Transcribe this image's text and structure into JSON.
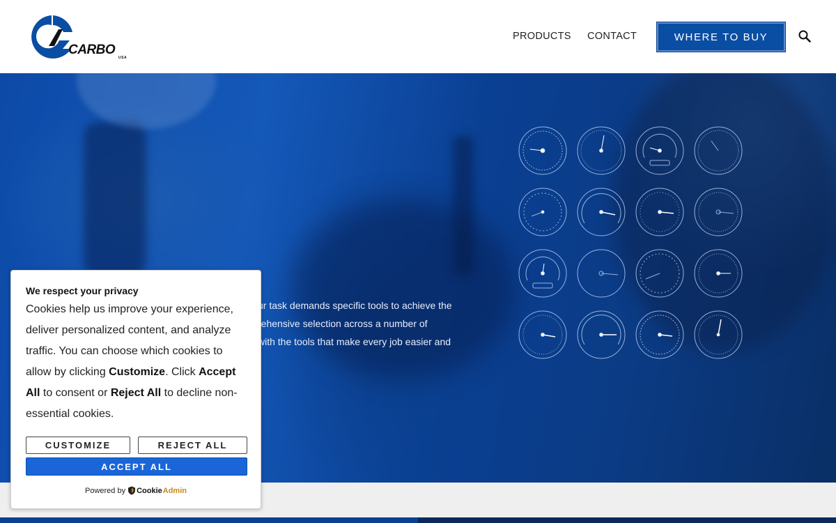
{
  "header": {
    "logo_text": "CARBO",
    "logo_sub": "USA",
    "nav": [
      "PRODUCTS",
      "CONTACT"
    ],
    "cta_label": "WHERE TO BUY"
  },
  "hero": {
    "lines": [
      "ur task demands specific tools to achieve the",
      "rehensive selection across a number of",
      "with the tools that make every job easier and"
    ]
  },
  "cookie": {
    "title": "We respect your privacy",
    "body_1": "Cookies help us improve your experience, deliver personalized content, and analyze traffic. You can choose which cookies to allow by clicking ",
    "customize_word": "Customize",
    "body_2": ". Click ",
    "accept_word": "Accept All",
    "body_3": " to consent or ",
    "reject_word": "Reject All",
    "body_4": " to decline non-essential cookies.",
    "btn_customize": "CUSTOMIZE",
    "btn_reject": "REJECT ALL",
    "btn_accept": "ACCEPT ALL",
    "powered_by": "Powered by",
    "brand_a": "Cookie",
    "brand_b": "Admin"
  },
  "colors": {
    "brand_blue": "#0a4ea3",
    "accept_blue": "#1a66d8",
    "header_bg": "#ffffff"
  }
}
